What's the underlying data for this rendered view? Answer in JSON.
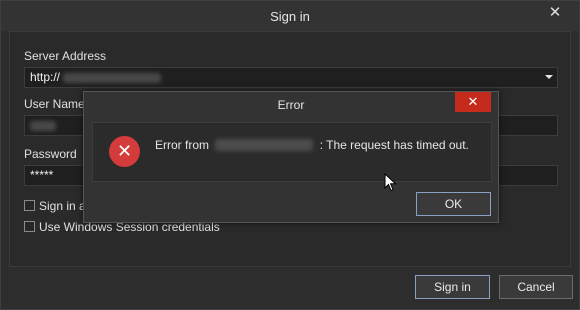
{
  "window": {
    "title": "Sign in",
    "close_glyph": "✕"
  },
  "form": {
    "server_address_label": "Server Address",
    "server_address_value": "http://",
    "user_name_label": "User Name",
    "password_label": "Password",
    "password_value": "*****",
    "sign_in_as_label": "Sign in a",
    "windows_session_label": "Use Windows Session credentials"
  },
  "footer": {
    "sign_in_label": "Sign in",
    "cancel_label": "Cancel"
  },
  "error_dialog": {
    "title": "Error",
    "close_glyph": "✕",
    "message_prefix": "Error from",
    "message_suffix": ": The request has timed out.",
    "ok_label": "OK",
    "icon": "error-x-icon",
    "icon_glyph": "✕"
  },
  "colors": {
    "error_red": "#d43b3b",
    "close_red": "#c42b1c",
    "accent_border": "#8aa1c4"
  }
}
